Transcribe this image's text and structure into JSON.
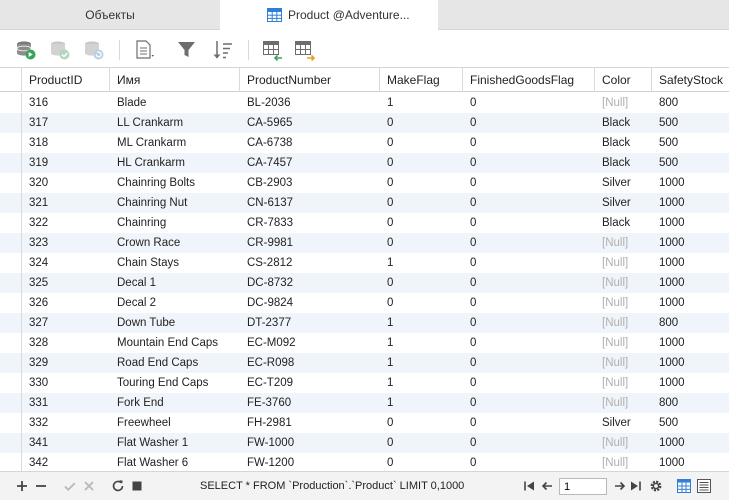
{
  "tabs": {
    "objects": "Объекты",
    "product": "Product @Adventure..."
  },
  "columns": [
    "ProductID",
    "Имя",
    "ProductNumber",
    "MakeFlag",
    "FinishedGoodsFlag",
    "Color",
    "SafetyStock"
  ],
  "rows": [
    [
      "316",
      "Blade",
      "BL-2036",
      "1",
      "0",
      "[Null]",
      "800"
    ],
    [
      "317",
      "LL Crankarm",
      "CA-5965",
      "0",
      "0",
      "Black",
      "500"
    ],
    [
      "318",
      "ML Crankarm",
      "CA-6738",
      "0",
      "0",
      "Black",
      "500"
    ],
    [
      "319",
      "HL Crankarm",
      "CA-7457",
      "0",
      "0",
      "Black",
      "500"
    ],
    [
      "320",
      "Chainring Bolts",
      "CB-2903",
      "0",
      "0",
      "Silver",
      "1000"
    ],
    [
      "321",
      "Chainring Nut",
      "CN-6137",
      "0",
      "0",
      "Silver",
      "1000"
    ],
    [
      "322",
      "Chainring",
      "CR-7833",
      "0",
      "0",
      "Black",
      "1000"
    ],
    [
      "323",
      "Crown Race",
      "CR-9981",
      "0",
      "0",
      "[Null]",
      "1000"
    ],
    [
      "324",
      "Chain Stays",
      "CS-2812",
      "1",
      "0",
      "[Null]",
      "1000"
    ],
    [
      "325",
      "Decal 1",
      "DC-8732",
      "0",
      "0",
      "[Null]",
      "1000"
    ],
    [
      "326",
      "Decal 2",
      "DC-9824",
      "0",
      "0",
      "[Null]",
      "1000"
    ],
    [
      "327",
      "Down Tube",
      "DT-2377",
      "1",
      "0",
      "[Null]",
      "800"
    ],
    [
      "328",
      "Mountain End Caps",
      "EC-M092",
      "1",
      "0",
      "[Null]",
      "1000"
    ],
    [
      "329",
      "Road End Caps",
      "EC-R098",
      "1",
      "0",
      "[Null]",
      "1000"
    ],
    [
      "330",
      "Touring End Caps",
      "EC-T209",
      "1",
      "0",
      "[Null]",
      "1000"
    ],
    [
      "331",
      "Fork End",
      "FE-3760",
      "1",
      "0",
      "[Null]",
      "800"
    ],
    [
      "332",
      "Freewheel",
      "FH-2981",
      "0",
      "0",
      "Silver",
      "500"
    ],
    [
      "341",
      "Flat Washer 1",
      "FW-1000",
      "0",
      "0",
      "[Null]",
      "1000"
    ],
    [
      "342",
      "Flat Washer 6",
      "FW-1200",
      "0",
      "0",
      "[Null]",
      "1000"
    ]
  ],
  "status": {
    "sql": "SELECT * FROM `Production`.`Product` LIMIT 0,1000",
    "page": "1"
  },
  "colors": {
    "accent": "#2f7fd6",
    "row_alt": "#f0f5fc",
    "null_text": "#b0b0b0",
    "green": "#3aa35a"
  }
}
